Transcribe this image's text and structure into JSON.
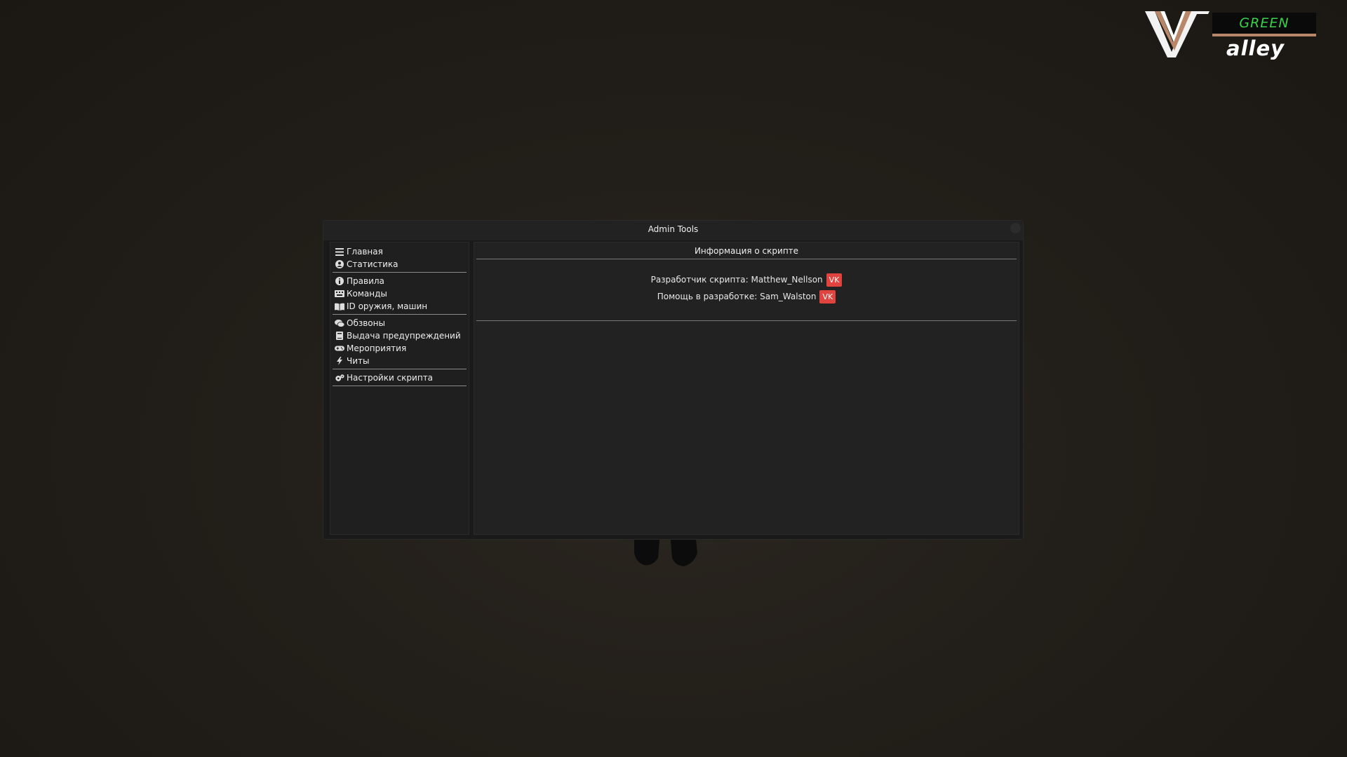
{
  "logo": {
    "green": "GREEN",
    "alley": "alley"
  },
  "window": {
    "title": "Admin Tools",
    "sidebar": {
      "items": [
        {
          "icon": "menu-icon",
          "label": "Главная"
        },
        {
          "icon": "user-circle-icon",
          "label": "Статистика"
        },
        {
          "icon": "info-icon",
          "label": "Правила"
        },
        {
          "icon": "keyboard-icon",
          "label": "Команды"
        },
        {
          "icon": "book-icon",
          "label": "ID оружия, машин"
        },
        {
          "icon": "chat-icon",
          "label": "Обзвоны"
        },
        {
          "icon": "notebook-icon",
          "label": "Выдача предупреждений"
        },
        {
          "icon": "gamepad-icon",
          "label": "Мероприятия"
        },
        {
          "icon": "lightning-icon",
          "label": "Читы"
        },
        {
          "icon": "gears-icon",
          "label": "Настройки скрипта"
        }
      ]
    },
    "main": {
      "header": "Информация о скрипте",
      "developer": "Разработчик скрипта: Matthew_Nellson",
      "helper": "Помощь в разработке: Sam_Walston",
      "vk_label": "VK"
    }
  },
  "colors": {
    "vk": "#e1433f",
    "logo_green": "#39d14a",
    "logo_stripe": "#b8876a"
  }
}
